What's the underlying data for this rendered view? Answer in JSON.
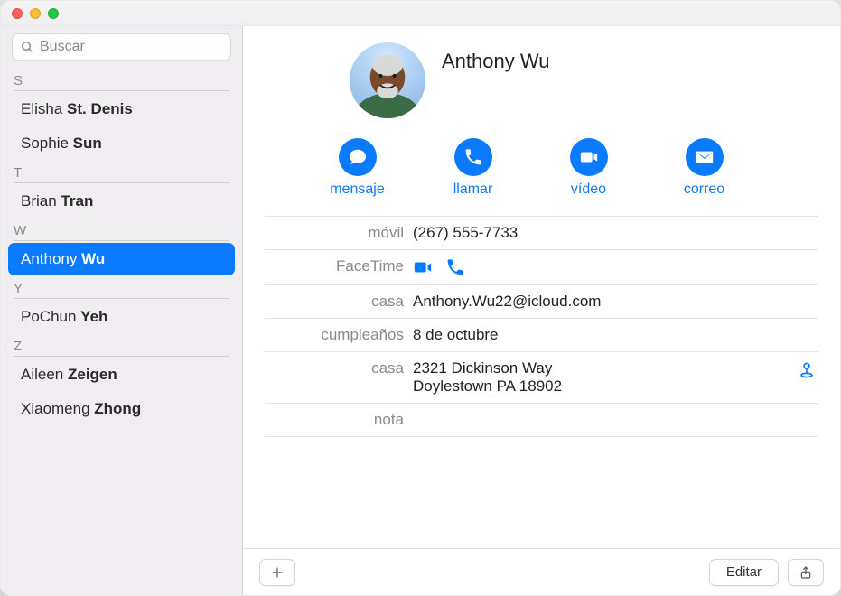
{
  "search": {
    "placeholder": "Buscar"
  },
  "sidebar": {
    "sections": [
      {
        "letter": "S",
        "items": [
          {
            "first": "Elisha",
            "last": "St. Denis",
            "selected": false
          },
          {
            "first": "Sophie",
            "last": "Sun",
            "selected": false
          }
        ]
      },
      {
        "letter": "T",
        "items": [
          {
            "first": "Brian",
            "last": "Tran",
            "selected": false
          }
        ]
      },
      {
        "letter": "W",
        "items": [
          {
            "first": "Anthony",
            "last": "Wu",
            "selected": true
          }
        ]
      },
      {
        "letter": "Y",
        "items": [
          {
            "first": "PoChun",
            "last": "Yeh",
            "selected": false
          }
        ]
      },
      {
        "letter": "Z",
        "items": [
          {
            "first": "Aileen",
            "last": "Zeigen",
            "selected": false
          },
          {
            "first": "Xiaomeng",
            "last": "Zhong",
            "selected": false
          }
        ]
      }
    ]
  },
  "contact": {
    "name": "Anthony Wu",
    "actions": {
      "message": "mensaje",
      "call": "llamar",
      "video": "vídeo",
      "mail": "correo"
    },
    "fields": {
      "mobile_label": "móvil",
      "mobile_value": "(267) 555-7733",
      "facetime_label": "FaceTime",
      "home_email_label": "casa",
      "home_email_value": "Anthony.Wu22@icloud.com",
      "birthday_label": "cumpleaños",
      "birthday_value": "8 de octubre",
      "home_addr_label": "casa",
      "home_addr_value": "2321 Dickinson Way\nDoylestown PA 18902",
      "note_label": "nota"
    }
  },
  "toolbar": {
    "edit": "Editar"
  },
  "colors": {
    "accent": "#0a7bff"
  }
}
